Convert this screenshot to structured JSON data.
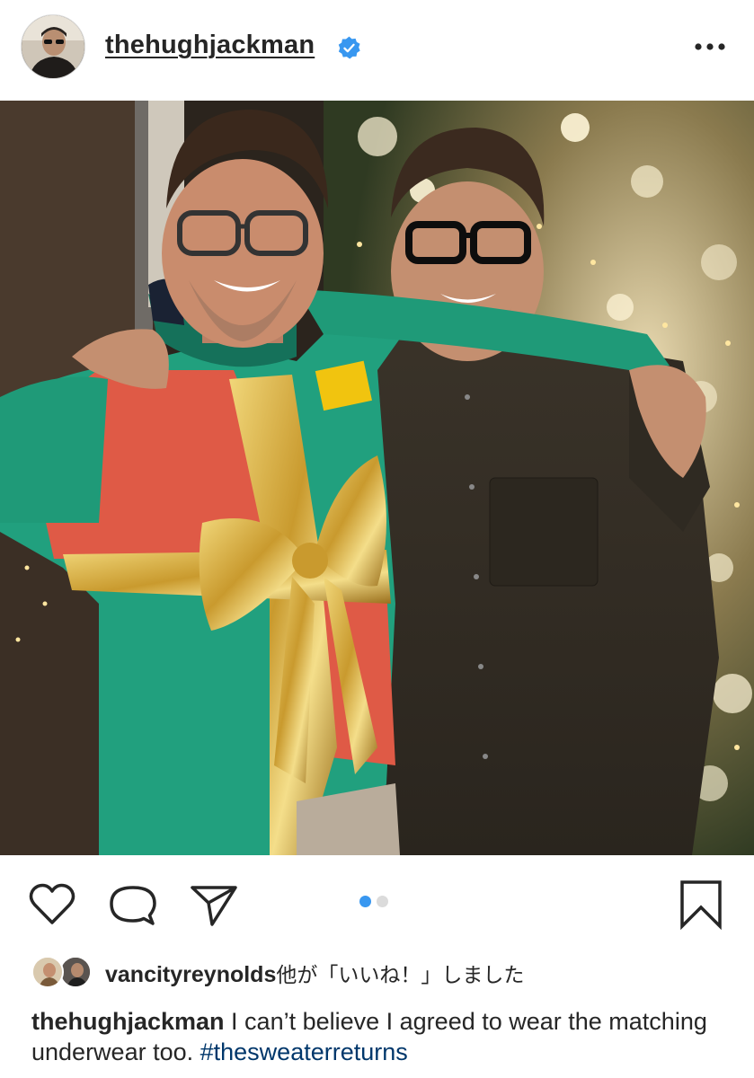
{
  "header": {
    "username": "thehughjackman",
    "verified": true,
    "avatar_icon": "profile-photo",
    "more_icon": "ellipsis-icon"
  },
  "photo": {
    "description_icon": "post-photo"
  },
  "actions": {
    "like_icon": "heart-icon",
    "comment_icon": "comment-icon",
    "share_icon": "paper-plane-icon",
    "save_icon": "bookmark-icon",
    "carousel": {
      "total": 2,
      "current": 1,
      "active_color": "#3897f0",
      "inactive_color": "#dbdbdb"
    }
  },
  "likes": {
    "user": "vancityreynolds",
    "rest": "他が「いいね！」しました"
  },
  "caption": {
    "user": "thehughjackman",
    "text": " I can’t believe I agreed to wear the matching underwear too. ",
    "hashtag": "#thesweaterreturns"
  },
  "colors": {
    "text": "#262626",
    "hashtag": "#00376b",
    "verified_blue": "#3897f0"
  }
}
